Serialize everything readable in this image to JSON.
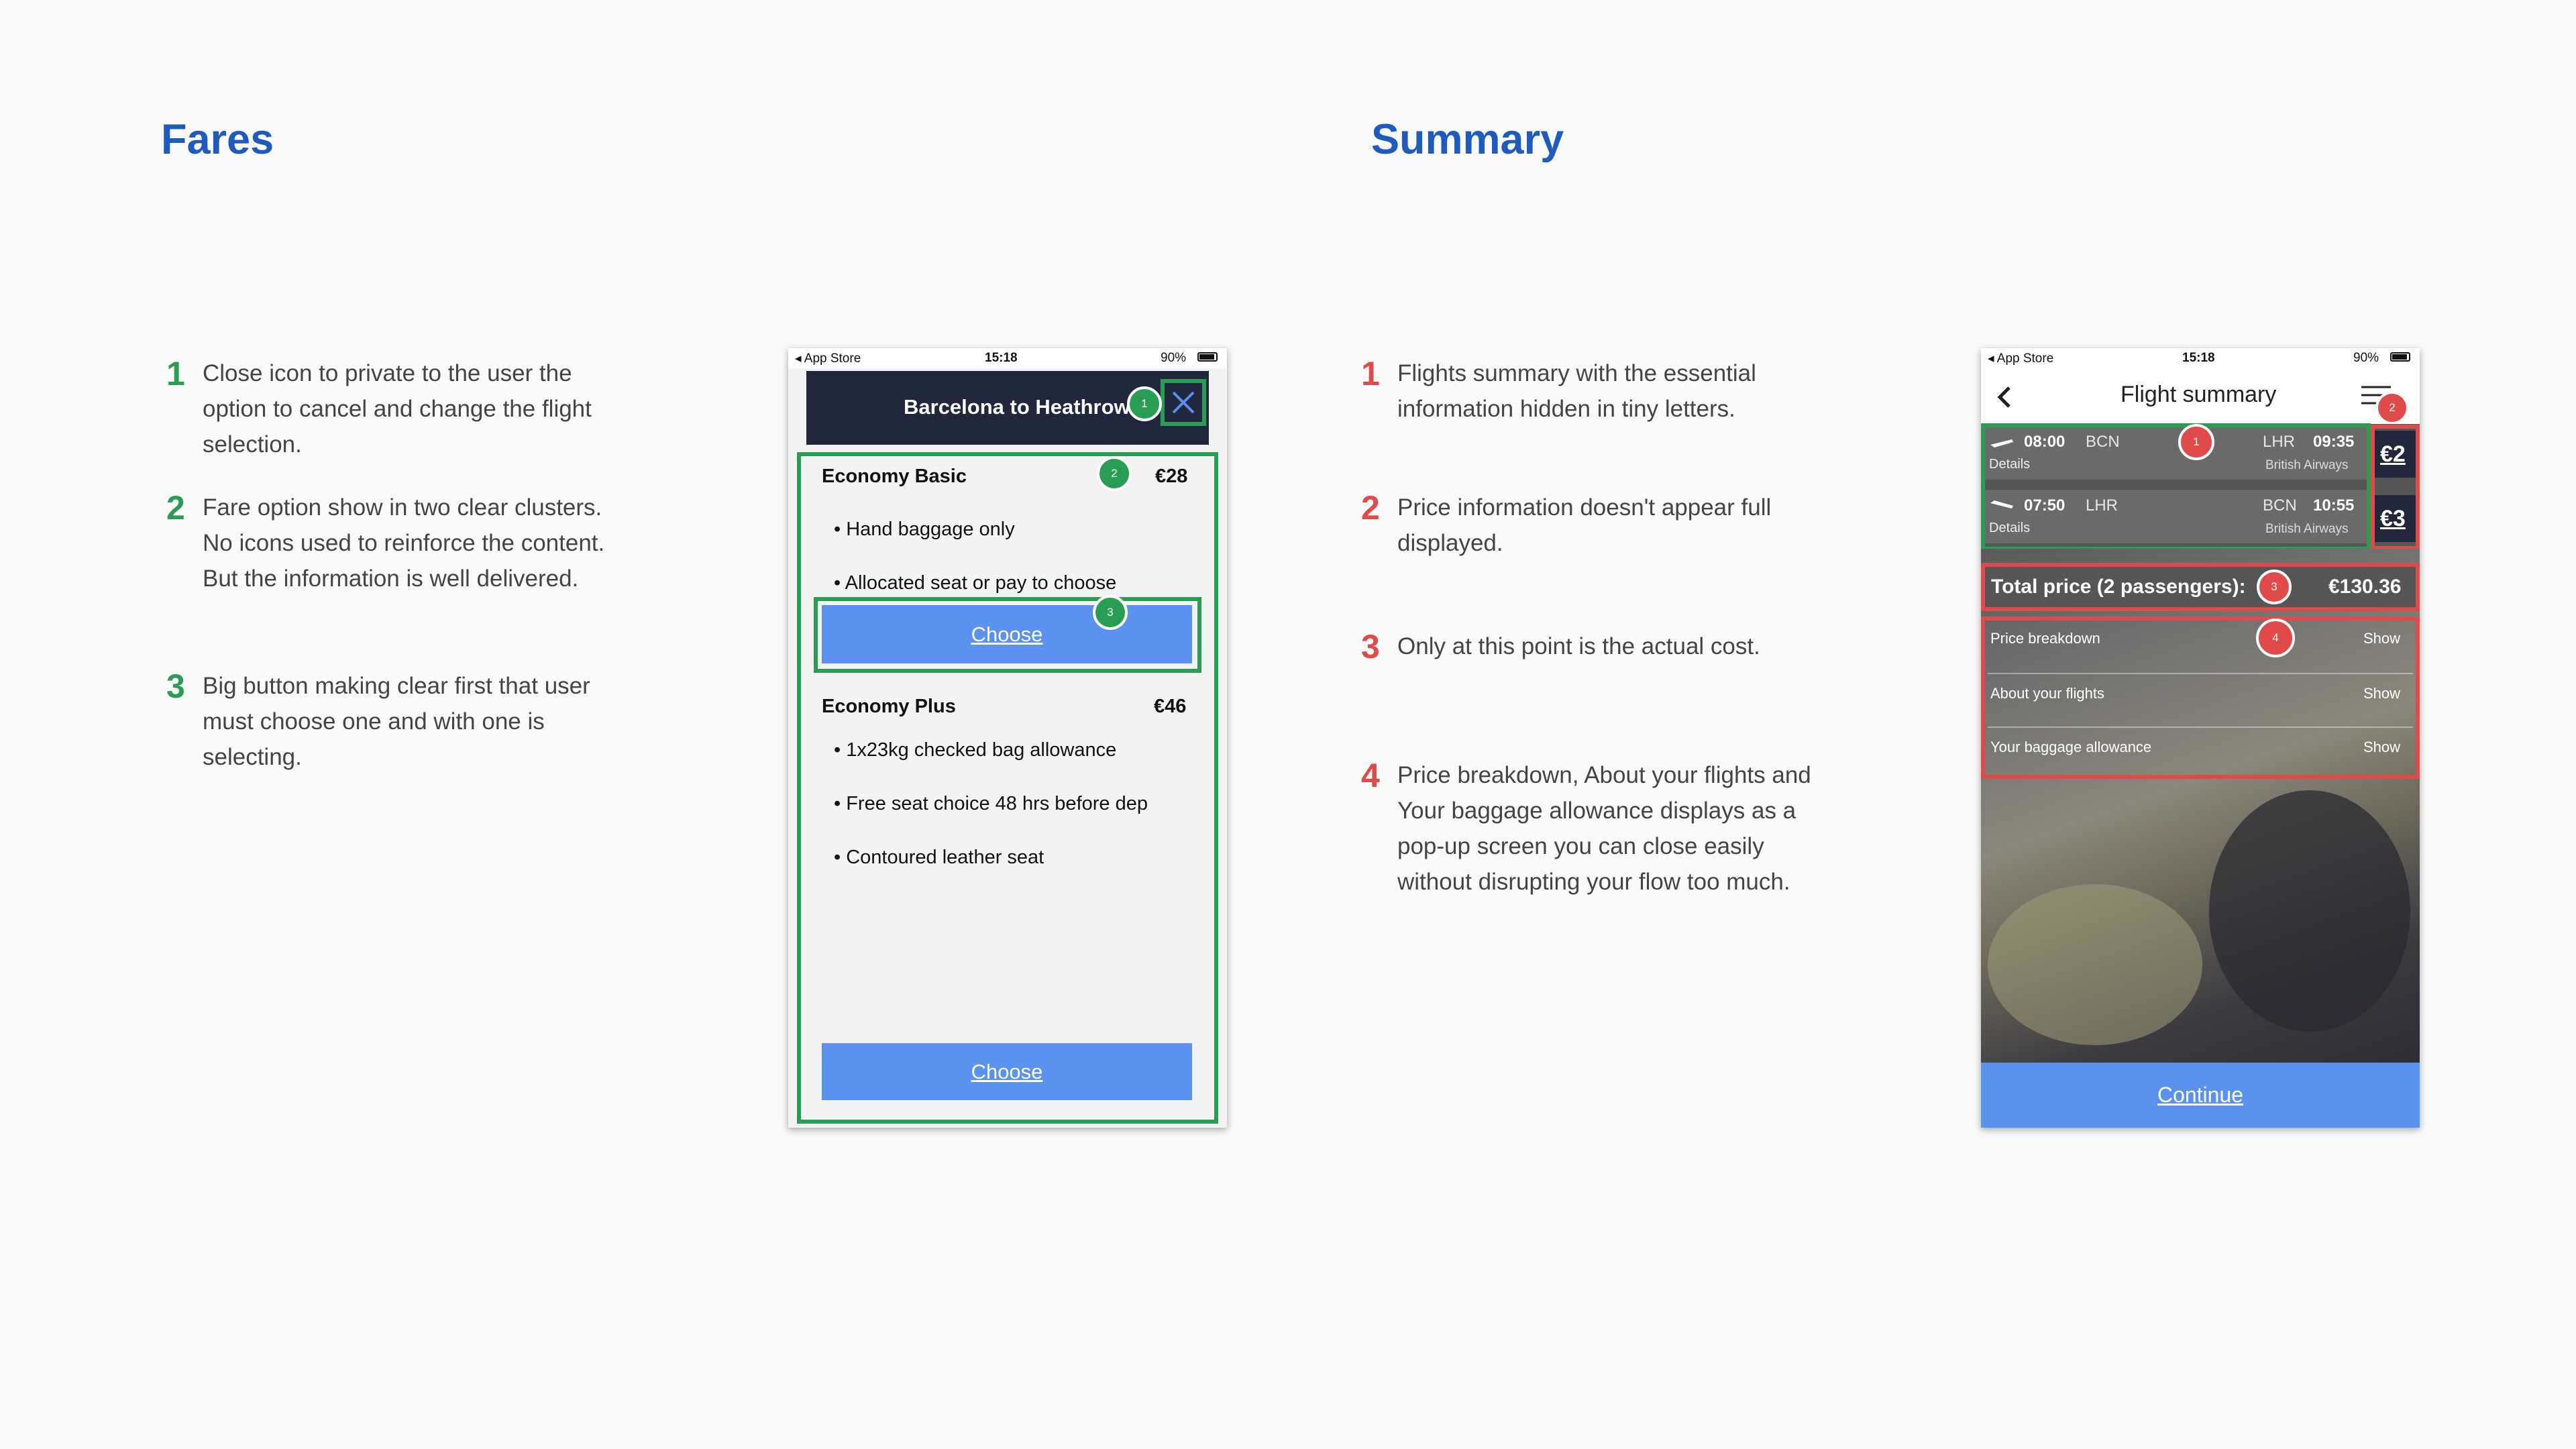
{
  "fares": {
    "heading": "Fares",
    "notes": [
      {
        "num": "1",
        "text": "Close icon to private to the user the option to cancel and change the flight selection."
      },
      {
        "num": "2",
        "text": "Fare option show in two clear clusters. No icons used to reinforce the content. But the information is well delivered."
      },
      {
        "num": "3",
        "text": "Big button making clear first that user must choose one and with one is selecting."
      }
    ],
    "phone": {
      "status_left": "◂ App Store",
      "status_time": "15:18",
      "status_right": "90%",
      "header_title": "Barcelona to Heathrow",
      "markers": [
        "1",
        "2",
        "3"
      ],
      "basic": {
        "title": "Economy Basic",
        "price": "€28",
        "items": [
          "• Hand baggage only",
          "• Allocated seat or pay to choose"
        ],
        "button": "Choose"
      },
      "plus": {
        "title": "Economy Plus",
        "price": "€46",
        "items": [
          "• 1x23kg checked bag allowance",
          "• Free seat choice 48 hrs before dep",
          "• Contoured leather seat"
        ],
        "button": "Choose"
      }
    }
  },
  "summary": {
    "heading": "Summary",
    "notes": [
      {
        "num": "1",
        "text": "Flights summary with the essential information hidden in tiny letters."
      },
      {
        "num": "2",
        "text": "Price information doesn't appear full displayed."
      },
      {
        "num": "3",
        "text": "Only at this point is the actual cost."
      },
      {
        "num": "4",
        "text": "Price breakdown, About your flights and Your baggage allowance displays as a pop-up screen you can close easily without disrupting your flow too much."
      }
    ],
    "phone": {
      "status_left": "◂ App Store",
      "status_time": "15:18",
      "status_right": "90%",
      "title": "Flight summary",
      "markers": [
        "1",
        "2",
        "3",
        "4"
      ],
      "flights": [
        {
          "dep_time": "08:00",
          "dep": "BCN",
          "arr": "LHR",
          "arr_time": "09:35",
          "details": "Details",
          "airline": "British Airways",
          "price": "€2"
        },
        {
          "dep_time": "07:50",
          "dep": "LHR",
          "arr": "BCN",
          "arr_time": "10:55",
          "details": "Details",
          "airline": "British Airways",
          "price": "€3"
        }
      ],
      "total_label": "Total price (2 passengers):",
      "total_value": "€130.36",
      "rows": [
        {
          "label": "Price breakdown",
          "action": "Show"
        },
        {
          "label": "About your flights",
          "action": "Show"
        },
        {
          "label": "Your baggage allowance",
          "action": "Show"
        }
      ],
      "continue": "Continue"
    }
  },
  "colors": {
    "accent_blue": "#1f5bbf",
    "green": "#2a9d55",
    "red": "#e04a4a",
    "button_blue": "#5c92ef",
    "navy": "#20273d"
  }
}
